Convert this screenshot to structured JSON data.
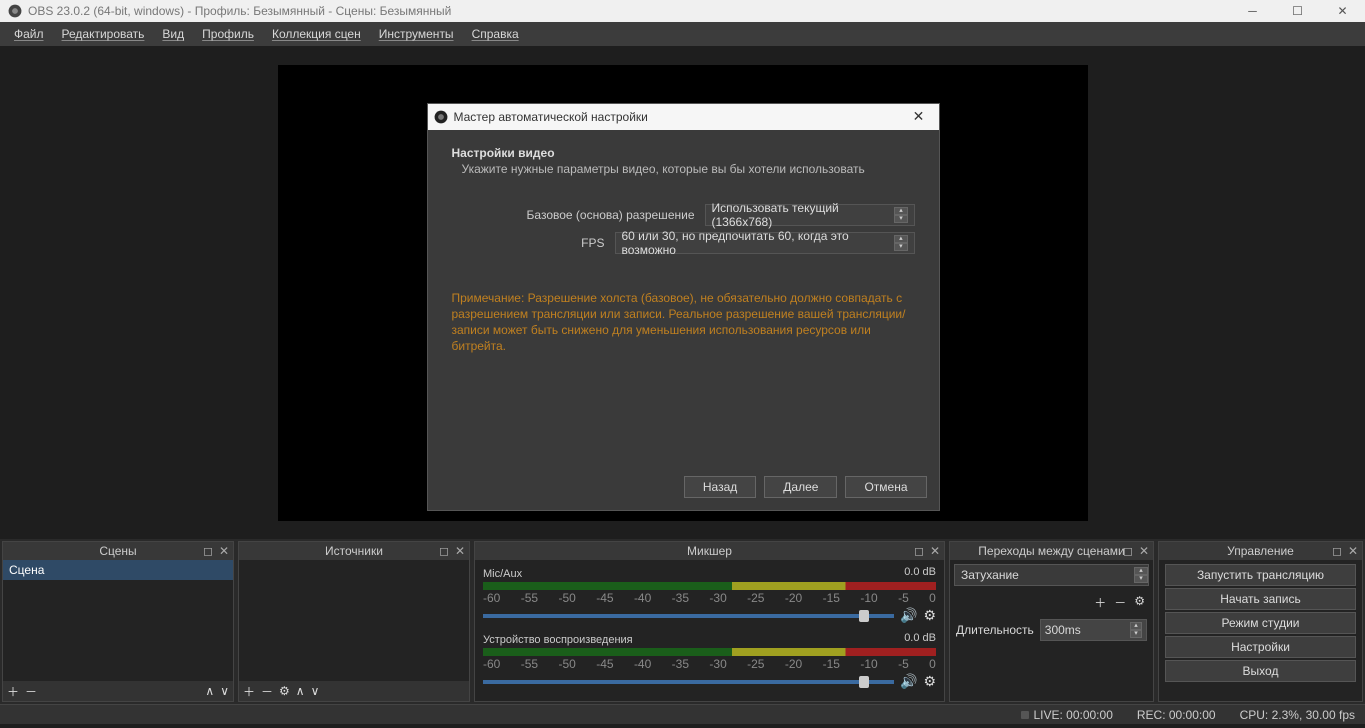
{
  "titlebar": {
    "text": "OBS 23.0.2 (64-bit, windows) - Профиль: Безымянный - Сцены: Безымянный"
  },
  "menubar": [
    "Файл",
    "Редактировать",
    "Вид",
    "Профиль",
    "Коллекция сцен",
    "Инструменты",
    "Справка"
  ],
  "wizard": {
    "title": "Мастер автоматической настройки",
    "heading": "Настройки видео",
    "subheading": "Укажите нужные параметры видео, которые вы бы хотели использовать",
    "resolution_label": "Базовое (основа) разрешение",
    "resolution_value": "Использовать текущий (1366x768)",
    "fps_label": "FPS",
    "fps_value": "60 или 30, но предпочитать 60, когда это возможно",
    "note": "Примечание: Разрешение холста (базовое), не обязательно должно совпадать с разрешением трансляции или записи. Реальное разрешение вашей трансляции/записи может быть снижено для уменьшения использования ресурсов или битрейта.",
    "back": "Назад",
    "next": "Далее",
    "cancel": "Отмена"
  },
  "panels": {
    "scenes_title": "Сцены",
    "scene_item": "Сцена",
    "sources_title": "Источники",
    "mixer_title": "Микшер",
    "mixer": {
      "mic_label": "Mic/Aux",
      "mic_db": "0.0 dB",
      "desktop_label": "Устройство воспроизведения",
      "desktop_db": "0.0 dB",
      "ticks": [
        "-60",
        "-55",
        "-50",
        "-45",
        "-40",
        "-35",
        "-30",
        "-25",
        "-20",
        "-15",
        "-10",
        "-5",
        "0"
      ]
    },
    "transitions_title": "Переходы между сценами",
    "transition_value": "Затухание",
    "duration_label": "Длительность",
    "duration_value": "300ms",
    "controls_title": "Управление",
    "controls": [
      "Запустить трансляцию",
      "Начать запись",
      "Режим студии",
      "Настройки",
      "Выход"
    ]
  },
  "status": {
    "live": "LIVE: 00:00:00",
    "rec": "REC: 00:00:00",
    "cpu": "CPU: 2.3%, 30.00 fps"
  }
}
